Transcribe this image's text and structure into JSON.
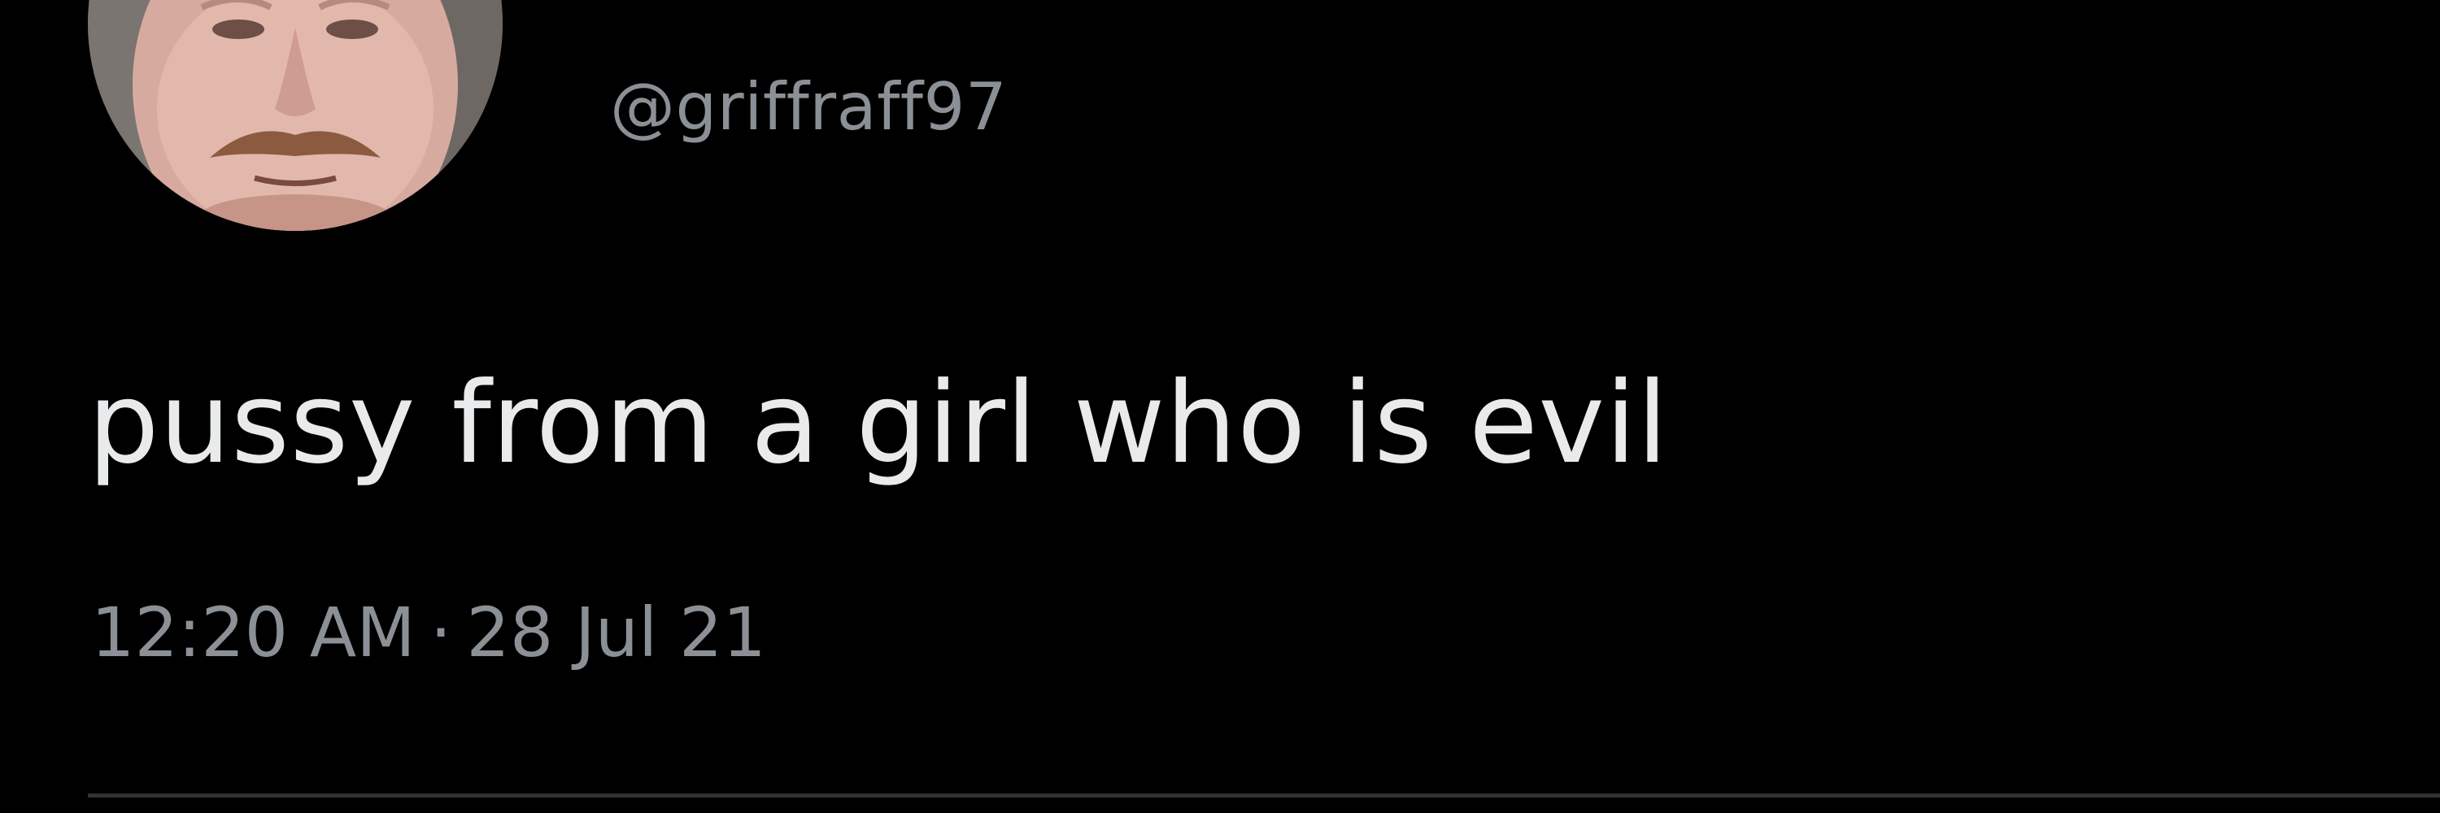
{
  "tweet": {
    "handle": "@griffraff97",
    "text": "pussy from a girl who is evil",
    "time": "12:20 AM",
    "separator": "·",
    "date": "28 Jul 21"
  },
  "icons": {
    "avatar": "profile-photo"
  },
  "colors": {
    "background": "#000000",
    "primary_text": "#e9eaeb",
    "secondary_text": "#8b9096",
    "divider": "#2f3336"
  }
}
